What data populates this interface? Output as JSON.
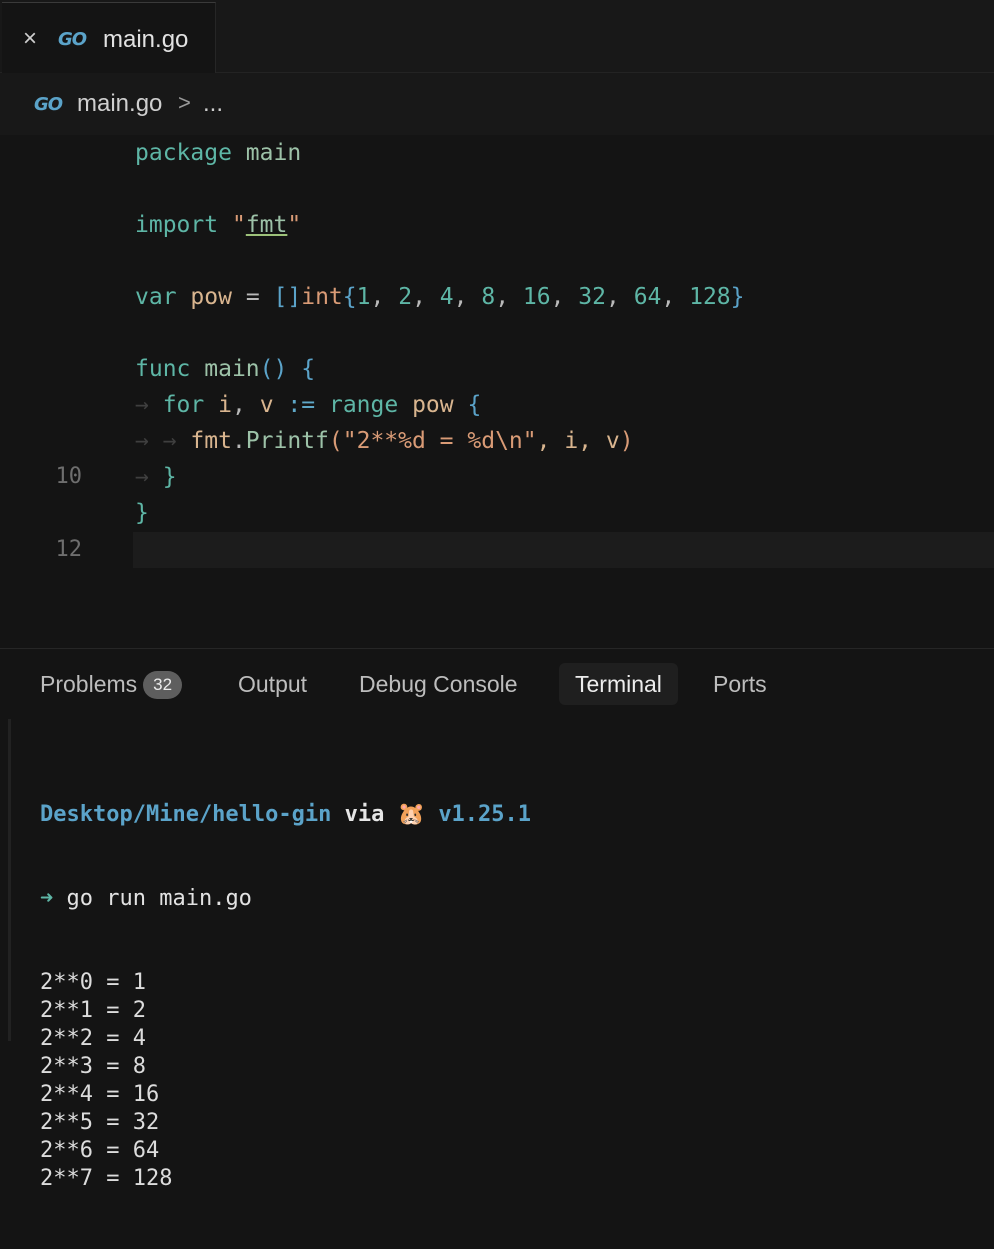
{
  "tab": {
    "close_icon": "close-icon",
    "logo": "GO",
    "label": "main.go"
  },
  "breadcrumb": {
    "logo": "GO",
    "file": "main.go",
    "separator": ">",
    "more": "..."
  },
  "editor": {
    "line_numbers": {
      "l10": "10",
      "l12": "12"
    },
    "lines": {
      "l1": {
        "kw": "package",
        "name": "main"
      },
      "l3": {
        "kw": "import",
        "q1": "\"",
        "pkg": "fmt",
        "q2": "\""
      },
      "l5": {
        "kw": "var",
        "name": "pow",
        "eq": "=",
        "slice": "[]",
        "type": "int",
        "open": "{",
        "values": [
          "1",
          "2",
          "4",
          "8",
          "16",
          "32",
          "64",
          "128"
        ],
        "close": "}"
      },
      "l7": {
        "kw": "func",
        "name": "main",
        "parens": "()",
        "open": "{"
      },
      "l8": {
        "kw": "for",
        "i": "i",
        "comma": ",",
        "v": "v",
        "assign": ":=",
        "range": "range",
        "pow": "pow",
        "open": "{"
      },
      "l9": {
        "pkg": "fmt",
        "dot": ".",
        "fn": "Printf",
        "lp": "(",
        "str": "\"2**%d = %d\\n\"",
        "args": ", i, v",
        "rp": ")"
      },
      "l10": {
        "close": "}"
      },
      "l11": {
        "close": "}"
      }
    }
  },
  "panel": {
    "tabs": [
      {
        "label": "Problems",
        "badge": "32"
      },
      {
        "label": "Output"
      },
      {
        "label": "Debug Console"
      },
      {
        "label": "Terminal",
        "active": true
      },
      {
        "label": "Ports"
      }
    ]
  },
  "terminal": {
    "prompt_path": "Desktop/Mine/hello-gin",
    "prompt_via": "via",
    "prompt_icon": "🐹",
    "prompt_version": "v1.25.1",
    "arrow": "➜",
    "command": "go run main.go",
    "output": [
      "2**0 = 1",
      "2**1 = 2",
      "2**2 = 4",
      "2**3 = 8",
      "2**4 = 16",
      "2**5 = 32",
      "2**6 = 64",
      "2**7 = 128"
    ]
  },
  "colors": {
    "background": "#141414",
    "keyword": "#5eb6a6",
    "string": "#d99b76",
    "accent": "#5ba3c9"
  }
}
